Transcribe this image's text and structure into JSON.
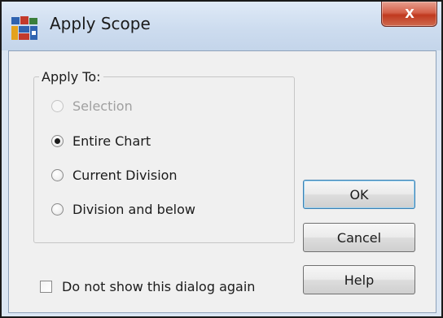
{
  "window": {
    "title": "Apply Scope",
    "icon": "chart-app-icon",
    "close_label": "X"
  },
  "scope_group": {
    "legend": "Apply To:",
    "options": [
      {
        "label": "Selection",
        "selected": false,
        "enabled": false
      },
      {
        "label": "Entire Chart",
        "selected": true,
        "enabled": true
      },
      {
        "label": "Current Division",
        "selected": false,
        "enabled": true
      },
      {
        "label": "Division and below",
        "selected": false,
        "enabled": true
      }
    ]
  },
  "buttons": {
    "ok": "OK",
    "cancel": "Cancel",
    "help": "Help"
  },
  "dont_show_again": {
    "label": "Do not show this dialog again",
    "checked": false
  },
  "colors": {
    "title_bar": "#cddcef",
    "close_button": "#c0391f",
    "client_background": "#f0f0f0",
    "default_button_border": "#3c7fb1"
  }
}
